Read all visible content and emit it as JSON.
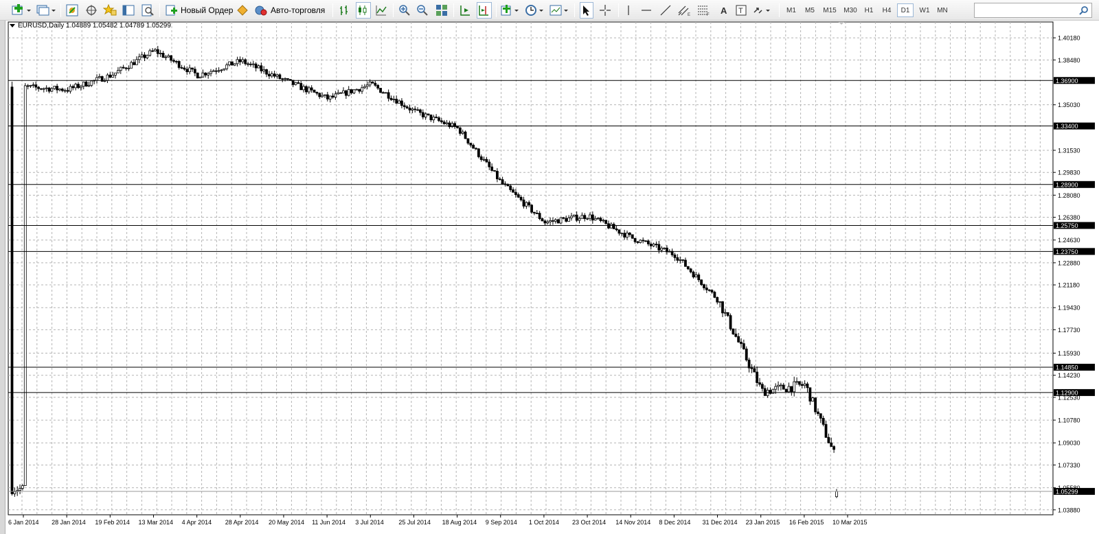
{
  "toolbar": {
    "new_order_label": "Новый Ордер",
    "auto_trading_label": "Авто-торговля",
    "timeframes": [
      "M1",
      "M5",
      "M15",
      "M30",
      "H1",
      "H4",
      "D1",
      "W1",
      "MN"
    ],
    "active_timeframe": "D1",
    "search_placeholder": ""
  },
  "chart": {
    "title": "EURUSD,Daily  1.04889 1.05482 1.04789 1.05299"
  },
  "chart_data": {
    "type": "candlestick",
    "symbol": "EURUSD",
    "period": "Daily",
    "ohlc_current": {
      "open": 1.04889,
      "high": 1.05482,
      "low": 1.04789,
      "close": 1.05299
    },
    "y_range": [
      1.035,
      1.414
    ],
    "price_ticks": [
      "1.40180",
      "1.38480",
      "1.35030",
      "1.31530",
      "1.29830",
      "1.28080",
      "1.26380",
      "1.24630",
      "1.22880",
      "1.21180",
      "1.19430",
      "1.17730",
      "1.15930",
      "1.14230",
      "1.12530",
      "1.10780",
      "1.09030",
      "1.07330",
      "1.05580",
      "1.03880"
    ],
    "horizontal_lines": [
      "1.36900",
      "1.33400",
      "1.28900",
      "1.25750",
      "1.23750",
      "1.14850",
      "1.12900"
    ],
    "current_price_label": "1.05299",
    "x_labels": [
      "6 Jan 2014",
      "28 Jan 2014",
      "19 Feb 2014",
      "13 Mar 2014",
      "4 Apr 2014",
      "28 Apr 2014",
      "20 May 2014",
      "11 Jun 2014",
      "3 Jul 2014",
      "25 Jul 2014",
      "18 Aug 2014",
      "9 Sep 2014",
      "1 Oct 2014",
      "23 Oct 2014",
      "14 Nov 2014",
      "8 Dec 2014",
      "31 Dec 2014",
      "23 Jan 2015",
      "16 Feb 2015",
      "10 Mar 2015"
    ],
    "close_path": [
      [
        "6 Jan 2014",
        1.364
      ],
      [
        "28 Jan 2014",
        1.362
      ],
      [
        "19 Feb 2014",
        1.373
      ],
      [
        "13 Mar 2014",
        1.392
      ],
      [
        "4 Apr 2014",
        1.373
      ],
      [
        "28 Apr 2014",
        1.384
      ],
      [
        "20 May 2014",
        1.369
      ],
      [
        "11 Jun 2014",
        1.355
      ],
      [
        "3 Jul 2014",
        1.366
      ],
      [
        "25 Jul 2014",
        1.345
      ],
      [
        "18 Aug 2014",
        1.332
      ],
      [
        "9 Sep 2014",
        1.29
      ],
      [
        "1 Oct 2014",
        1.26
      ],
      [
        "23 Oct 2014",
        1.265
      ],
      [
        "14 Nov 2014",
        1.248
      ],
      [
        "8 Dec 2014",
        1.235
      ],
      [
        "31 Dec 2014",
        1.2
      ],
      [
        "23 Jan 2015",
        1.13
      ],
      [
        "16 Feb 2015",
        1.135
      ],
      [
        "10 Mar 2015",
        1.055
      ]
    ]
  }
}
